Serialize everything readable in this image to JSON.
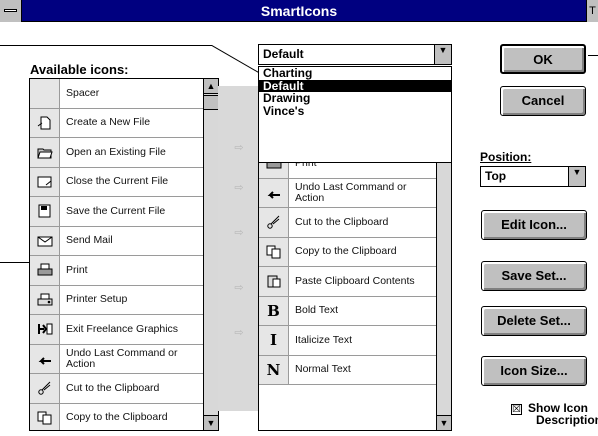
{
  "window": {
    "title": "SmartIcons",
    "right_glyph": "T"
  },
  "available": {
    "label": "Available icons:",
    "items": [
      {
        "icon": "spacer-icon",
        "label": "Spacer"
      },
      {
        "icon": "new-file-icon",
        "label": "Create a New File"
      },
      {
        "icon": "open-file-icon",
        "label": "Open an Existing File"
      },
      {
        "icon": "close-file-icon",
        "label": "Close the Current File"
      },
      {
        "icon": "save-file-icon",
        "label": "Save the Current File"
      },
      {
        "icon": "mail-icon",
        "label": "Send Mail"
      },
      {
        "icon": "print-icon",
        "label": "Print"
      },
      {
        "icon": "printer-setup-icon",
        "label": "Printer Setup"
      },
      {
        "icon": "exit-icon",
        "label": "Exit Freelance Graphics"
      },
      {
        "icon": "undo-icon",
        "label": "Undo Last Command or Action"
      },
      {
        "icon": "scissors-icon",
        "label": "Cut to the Clipboard"
      },
      {
        "icon": "copy-icon",
        "label": "Copy to the Clipboard"
      }
    ]
  },
  "set": {
    "selected": "Default",
    "options": [
      "Charting",
      "Default",
      "Drawing",
      "Vince's"
    ],
    "highlighted_index": 1,
    "items": [
      {
        "icon": "print-icon",
        "label": "Print"
      },
      {
        "icon": "undo-icon",
        "label": "Undo Last Command or Action"
      },
      {
        "icon": "scissors-icon",
        "label": "Cut to the Clipboard"
      },
      {
        "icon": "copy-icon",
        "label": "Copy to the Clipboard"
      },
      {
        "icon": "paste-icon",
        "label": "Paste Clipboard Contents"
      },
      {
        "icon": "bold-icon",
        "glyph": "B",
        "label": "Bold Text"
      },
      {
        "icon": "italic-icon",
        "glyph": "I",
        "label": "Italicize Text"
      },
      {
        "icon": "normal-text-icon",
        "glyph": "N",
        "label": "Normal Text"
      }
    ]
  },
  "buttons": {
    "ok": "OK",
    "cancel": "Cancel",
    "edit_icon": "Edit Icon...",
    "save_set": "Save Set...",
    "delete_set": "Delete Set...",
    "icon_size": "Icon Size..."
  },
  "position": {
    "label": "Position:",
    "value": "Top"
  },
  "show_descriptions": {
    "label_line1": "Show Icon",
    "label_line2": "Descriptions",
    "checked": true,
    "mark": "☒"
  }
}
